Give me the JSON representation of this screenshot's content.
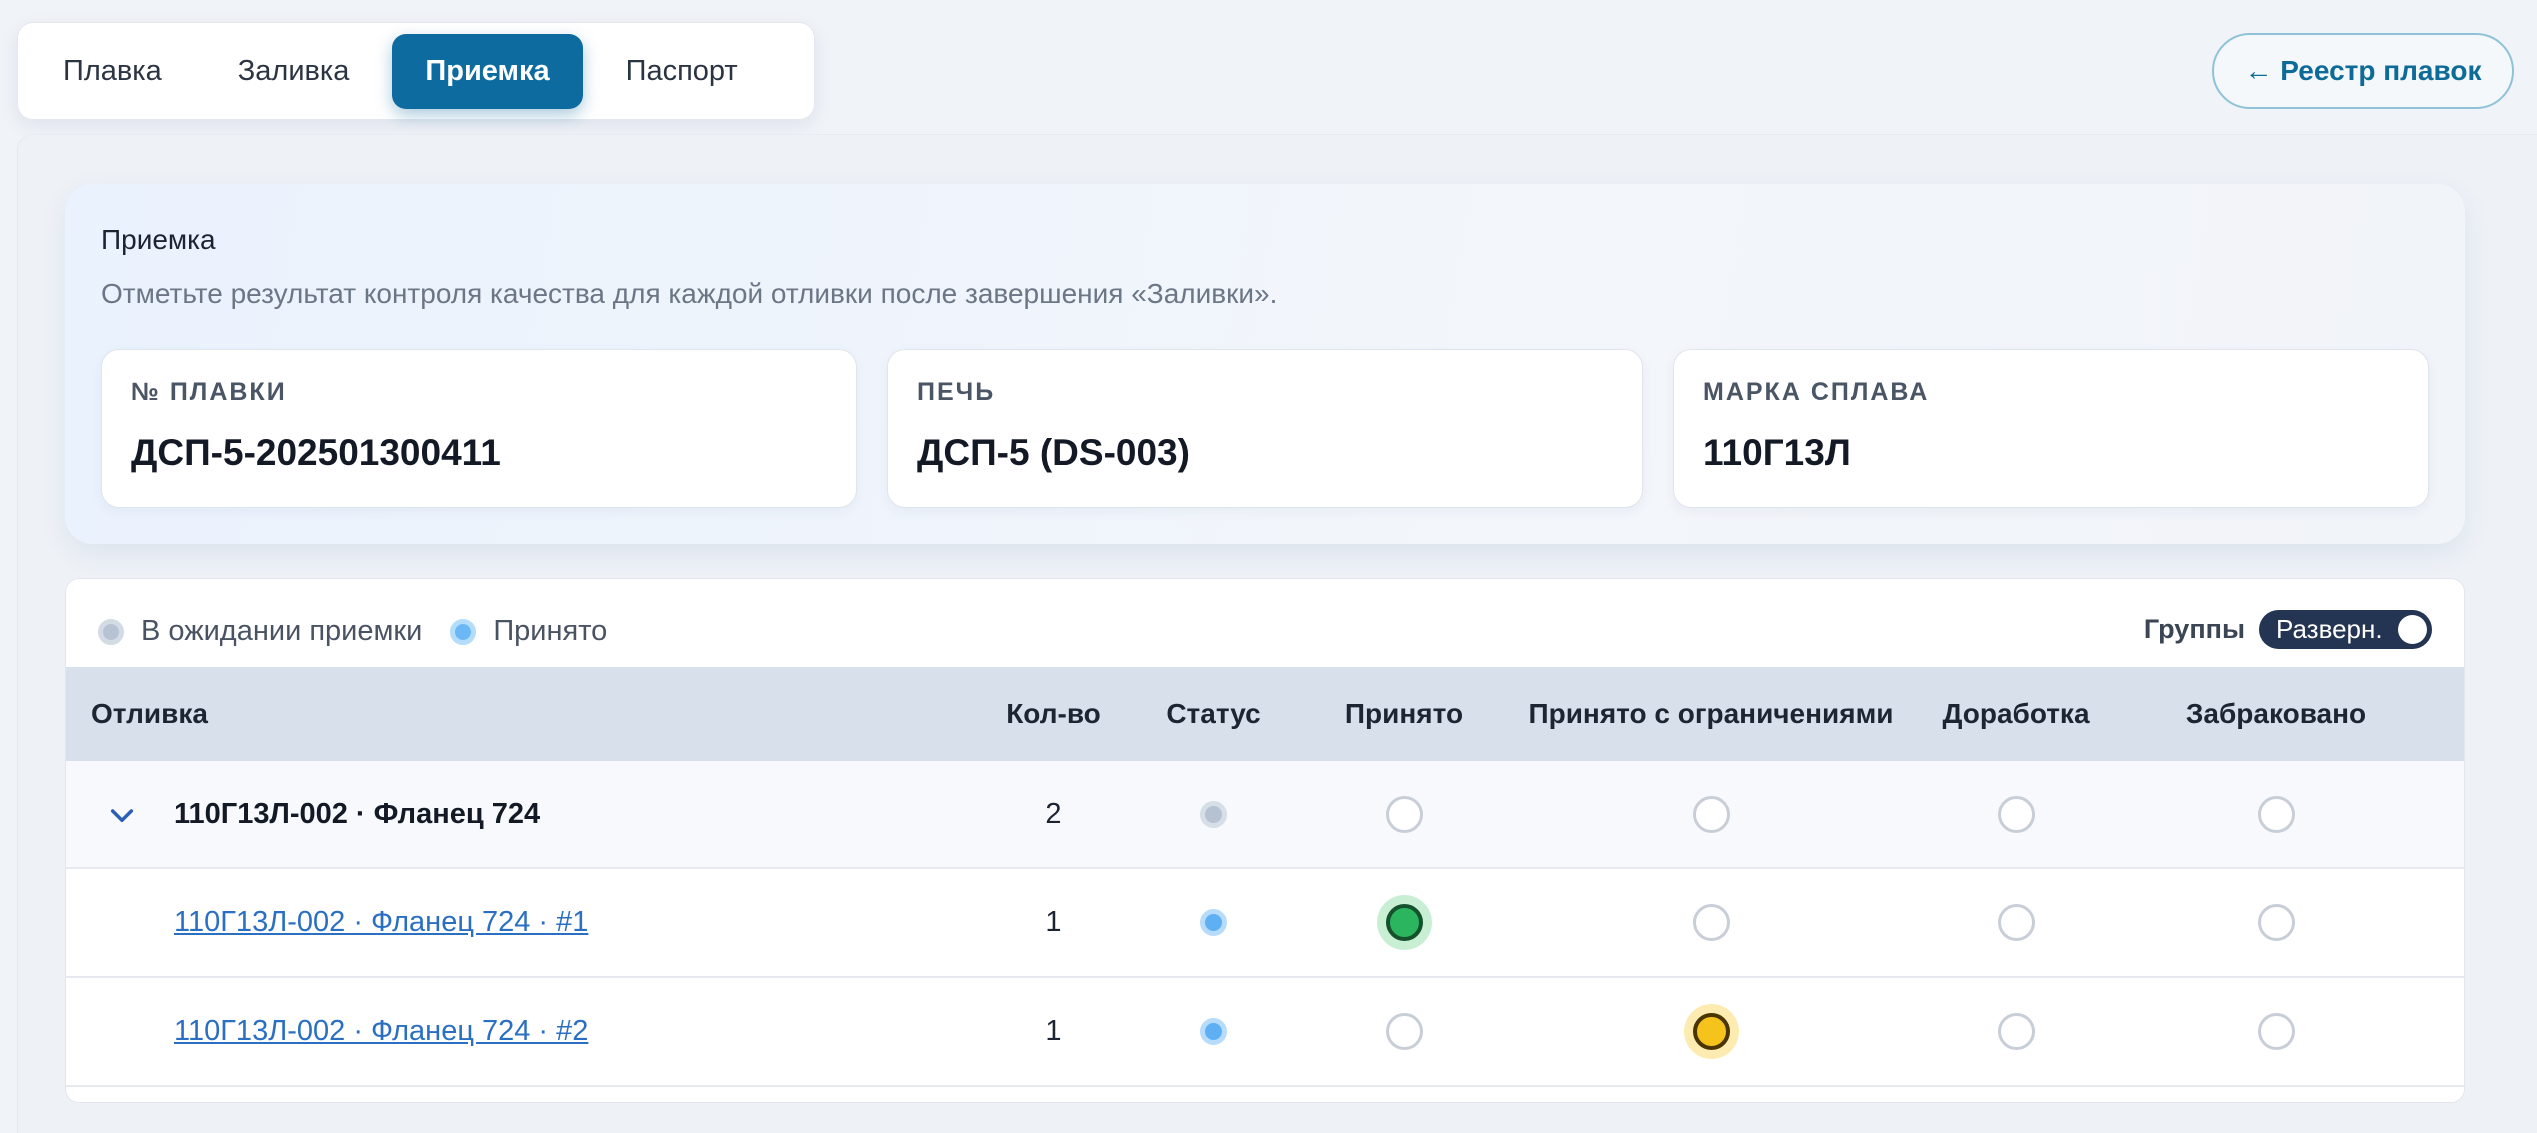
{
  "tabs": [
    {
      "label": "Плавка",
      "active": false
    },
    {
      "label": "Заливка",
      "active": false
    },
    {
      "label": "Приемка",
      "active": true
    },
    {
      "label": "Паспорт",
      "active": false
    }
  ],
  "registry_button": "← Реестр плавок",
  "header": {
    "title": "Приемка",
    "subtitle": "Отметьте результат контроля качества для каждой отливки после завершения «Заливки»."
  },
  "info_cards": [
    {
      "label": "№ ПЛАВКИ",
      "value": "ДСП-5-202501300411"
    },
    {
      "label": "ПЕЧЬ",
      "value": "ДСП-5 (DS-003)"
    },
    {
      "label": "МАРКА СПЛАВА",
      "value": "110Г13Л"
    }
  ],
  "legend": {
    "pending": "В ожидании приемки",
    "accepted": "Принято"
  },
  "groups": {
    "label": "Группы",
    "toggle": "Разверн."
  },
  "table": {
    "columns": [
      "Отливка",
      "Кол-во",
      "Статус",
      "Принято",
      "Принято с ограничениями",
      "Доработка",
      "Забраковано"
    ],
    "group_row": {
      "name": "110Г13Л-002 · Фланец 724",
      "qty": "2",
      "status": "pending",
      "selected": null
    },
    "rows": [
      {
        "name": "110Г13Л-002 · Фланец 724 · #1",
        "qty": "1",
        "status": "accepted",
        "selected": "Принято"
      },
      {
        "name": "110Г13Л-002 · Фланец 724 · #2",
        "qty": "1",
        "status": "accepted",
        "selected": "Принято с ограничениями"
      }
    ]
  },
  "colors": {
    "primary": "#0d6b9f",
    "accepted": "#2bb55e",
    "restricted": "#f6c31c",
    "status_blue": "#5eb0f3"
  }
}
